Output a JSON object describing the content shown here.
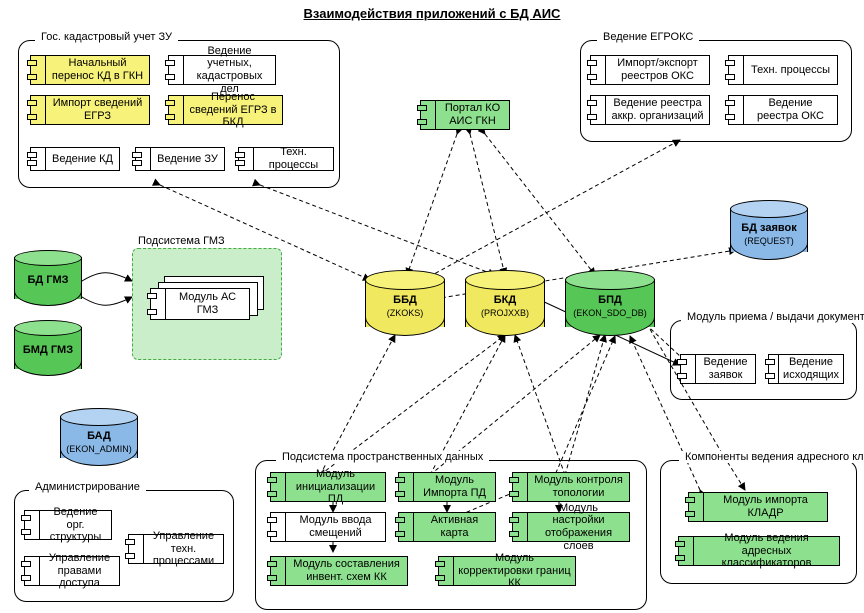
{
  "title": "Взаимодействия приложений с БД АИС",
  "groups": {
    "cadastre": "Гос. кадастровый учет ЗУ",
    "egroks": "Ведение ЕГРОКС",
    "gmz": "Подсистема ГМЗ",
    "request": "Модуль приема / выдачи документов",
    "admin": "Администрирование",
    "spatial": "Подсистема пространственных данных",
    "addr": "Компоненты ведения адресного классификатора"
  },
  "modules": {
    "cad_initial": "Начальный перенос КД в ГКН",
    "cad_records": "Ведение учетных, кадастровых дел",
    "cad_egrz": "Импорт сведений ЕГРЗ",
    "cad_transfer": "Перенос сведений ЕГРЗ в БКД",
    "cad_kd": "Ведение КД",
    "cad_zu": "Ведение ЗУ",
    "cad_tech": "Техн. процессы",
    "egroks_import": "Импорт/экспорт реестров ОКС",
    "egroks_tech": "Техн. процессы",
    "egroks_akkr": "Ведение реестра аккр. организаций",
    "egroks_oks": "Ведение реестра ОКС",
    "portal": "Портал КО АИС ГКН",
    "gmz_module": "Модуль АС ГМЗ",
    "req_requests": "Ведение заявок",
    "req_outgoing": "Ведение исходящих",
    "admin_org": "Ведение орг. структуры",
    "admin_rights": "Управление правами доступа",
    "admin_tech": "Управление техн. процессами",
    "sp_init": "Модуль инициализации ПД",
    "sp_import": "Модуль Импорта ПД",
    "sp_topo": "Модуль контроля топологии",
    "sp_offset": "Модуль ввода смещений",
    "sp_map": "Активная карта",
    "sp_layers": "Модуль настройки отображения слоев",
    "sp_invent": "Модуль составления инвент. схем КК",
    "sp_bounds": "Модуль корректировки границ КК",
    "addr_kladr": "Модуль импорта КЛАДР",
    "addr_maint": "Модуль ведения адресных классификаторов"
  },
  "dbs": {
    "bdgmz": {
      "label": "БД ГМЗ"
    },
    "bmdgmz": {
      "label": "БМД ГМЗ"
    },
    "bad": {
      "label": "БАД",
      "sub": "(EKON_ADMIN)"
    },
    "bbd": {
      "label": "ББД",
      "sub": "(ZKOKS)"
    },
    "bkd": {
      "label": "БКД",
      "sub": "(PROJXXB)"
    },
    "bpd": {
      "label": "БПД",
      "sub": "(EKON_SDO_DB)"
    },
    "breq": {
      "label": "БД заявок",
      "sub": "(REQUEST)"
    }
  },
  "colors": {
    "yellow": "#f7f27a",
    "green": "#8de08d",
    "blue": "#8ab9e8"
  }
}
